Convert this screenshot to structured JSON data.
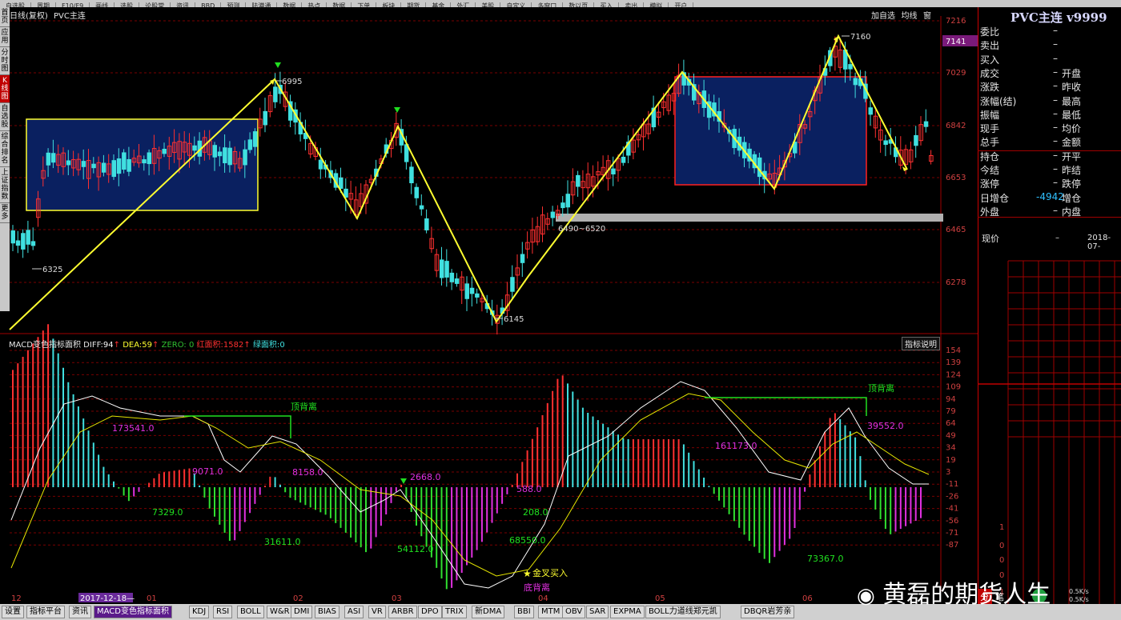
{
  "toolbar_items": [
    "自选股",
    "周期",
    "F10/F9",
    "画线",
    "选股",
    "论股堂",
    "资讯",
    "BBD",
    "预测",
    "陆港通",
    "数据",
    "热点",
    "数据",
    "下单",
    "板块",
    "期货",
    "基金",
    "外汇",
    "美股",
    "自定义",
    "多窗口",
    "数以页",
    "买入",
    "卖出",
    "模拟",
    "开户"
  ],
  "left_tabs": [
    "首页",
    "应用",
    "分时图",
    "K线图",
    "自选股",
    "综合排名",
    "上证指数",
    "更多"
  ],
  "chart_header": {
    "period": "日线(复权)",
    "symbol": "PVC主连"
  },
  "chart_buttons": [
    "加自选",
    "均线",
    "窗"
  ],
  "price_axis": {
    "labels": [
      "7216",
      "7141",
      "7029",
      "6842",
      "6653",
      "6465",
      "6278"
    ],
    "current": "7141"
  },
  "price_annotations": {
    "high1": "6995",
    "low1": "6325",
    "low2": "6145",
    "high2": "7160",
    "range": "6490~6520"
  },
  "macd_header": {
    "name": "MACD变色指标面积",
    "diff_label": "DIFF:",
    "diff_val": "94",
    "dea_label": "DEA:",
    "dea_val": "59",
    "zero": "ZERO: 0",
    "red_area_label": "红面积:",
    "red_area_val": "1582",
    "green_area_label": "绿面积:",
    "green_area_val": "0",
    "help_button": "指标说明"
  },
  "macd_axis": [
    "154",
    "139",
    "124",
    "109",
    "94",
    "79",
    "64",
    "49",
    "34",
    "19",
    "3",
    "-11",
    "-26",
    "-41",
    "-56",
    "-71",
    "-87"
  ],
  "macd_annotations": [
    "173541.0",
    "9071.0",
    "8158.0",
    "7329.0",
    "31611.0",
    "2668.0",
    "54112.0",
    "588.0",
    "208.0",
    "68550.0",
    "161173.0",
    "73367.0",
    "39552.0"
  ],
  "macd_labels": {
    "top_divergence": "顶背离",
    "bottom_divergence": "底背离",
    "golden_cross": "金叉买入"
  },
  "time_axis": [
    "12",
    "2017-12-18",
    "01",
    "02",
    "03",
    "04",
    "05",
    "06"
  ],
  "right_panel": {
    "title": "PVC主连 v9999",
    "rows": [
      {
        "l1": "委比",
        "v1": "–",
        "l2": ""
      },
      {
        "l1": "卖出",
        "v1": "–",
        "l2": ""
      },
      {
        "l1": "买入",
        "v1": "–",
        "l2": ""
      },
      {
        "l1": "成交",
        "v1": "–",
        "l2": "开盘"
      },
      {
        "l1": "涨跌",
        "v1": "–",
        "l2": "昨收"
      },
      {
        "l1": "涨幅(结)",
        "v1": "–",
        "l2": "最高"
      },
      {
        "l1": "振幅",
        "v1": "–",
        "l2": "最低"
      },
      {
        "l1": "现手",
        "v1": "–",
        "l2": "均价"
      },
      {
        "l1": "总手",
        "v1": "–",
        "l2": "金额"
      },
      {
        "l1": "持仓",
        "v1": "–",
        "l2": "开平"
      },
      {
        "l1": "今结",
        "v1": "–",
        "l2": "昨结"
      },
      {
        "l1": "涨停",
        "v1": "–",
        "l2": "跌停"
      },
      {
        "l1": "日增仓",
        "v1": "-4942",
        "l2": "增仓"
      },
      {
        "l1": "外盘",
        "v1": "–",
        "l2": "内盘"
      }
    ],
    "price_label": "现价",
    "price_value": "–",
    "date_value": "2018-07-",
    "mini_axis": [
      "1",
      "0",
      "0",
      "0",
      "1"
    ],
    "net_up": "0.5K/s",
    "net_down": "0.5K/s",
    "bottom_tabs": [
      "分",
      "笔"
    ]
  },
  "bottom_tabs": [
    "设置",
    "指标平台",
    "资讯",
    "MACD变色指标面积",
    "KDJ",
    "RSI",
    "BOLL",
    "W&R",
    "DMI",
    "BIAS",
    "ASI",
    "VR",
    "ARBR",
    "DPO",
    "TRIX",
    "新DMA",
    "BBI",
    "MTM",
    "OBV",
    "SAR",
    "EXPMA",
    "BOLL力道线郑元凯",
    "DBQR岩芳亲"
  ],
  "watermark": "黄磊的期货人生",
  "colors": {
    "up": "#ff3030",
    "down": "#40e0e0",
    "zig": "#ffff30",
    "box_fill": "#0a2060",
    "box1_border": "#ffff30",
    "box2_border": "#ff2020",
    "grid": "#7a0000"
  }
}
